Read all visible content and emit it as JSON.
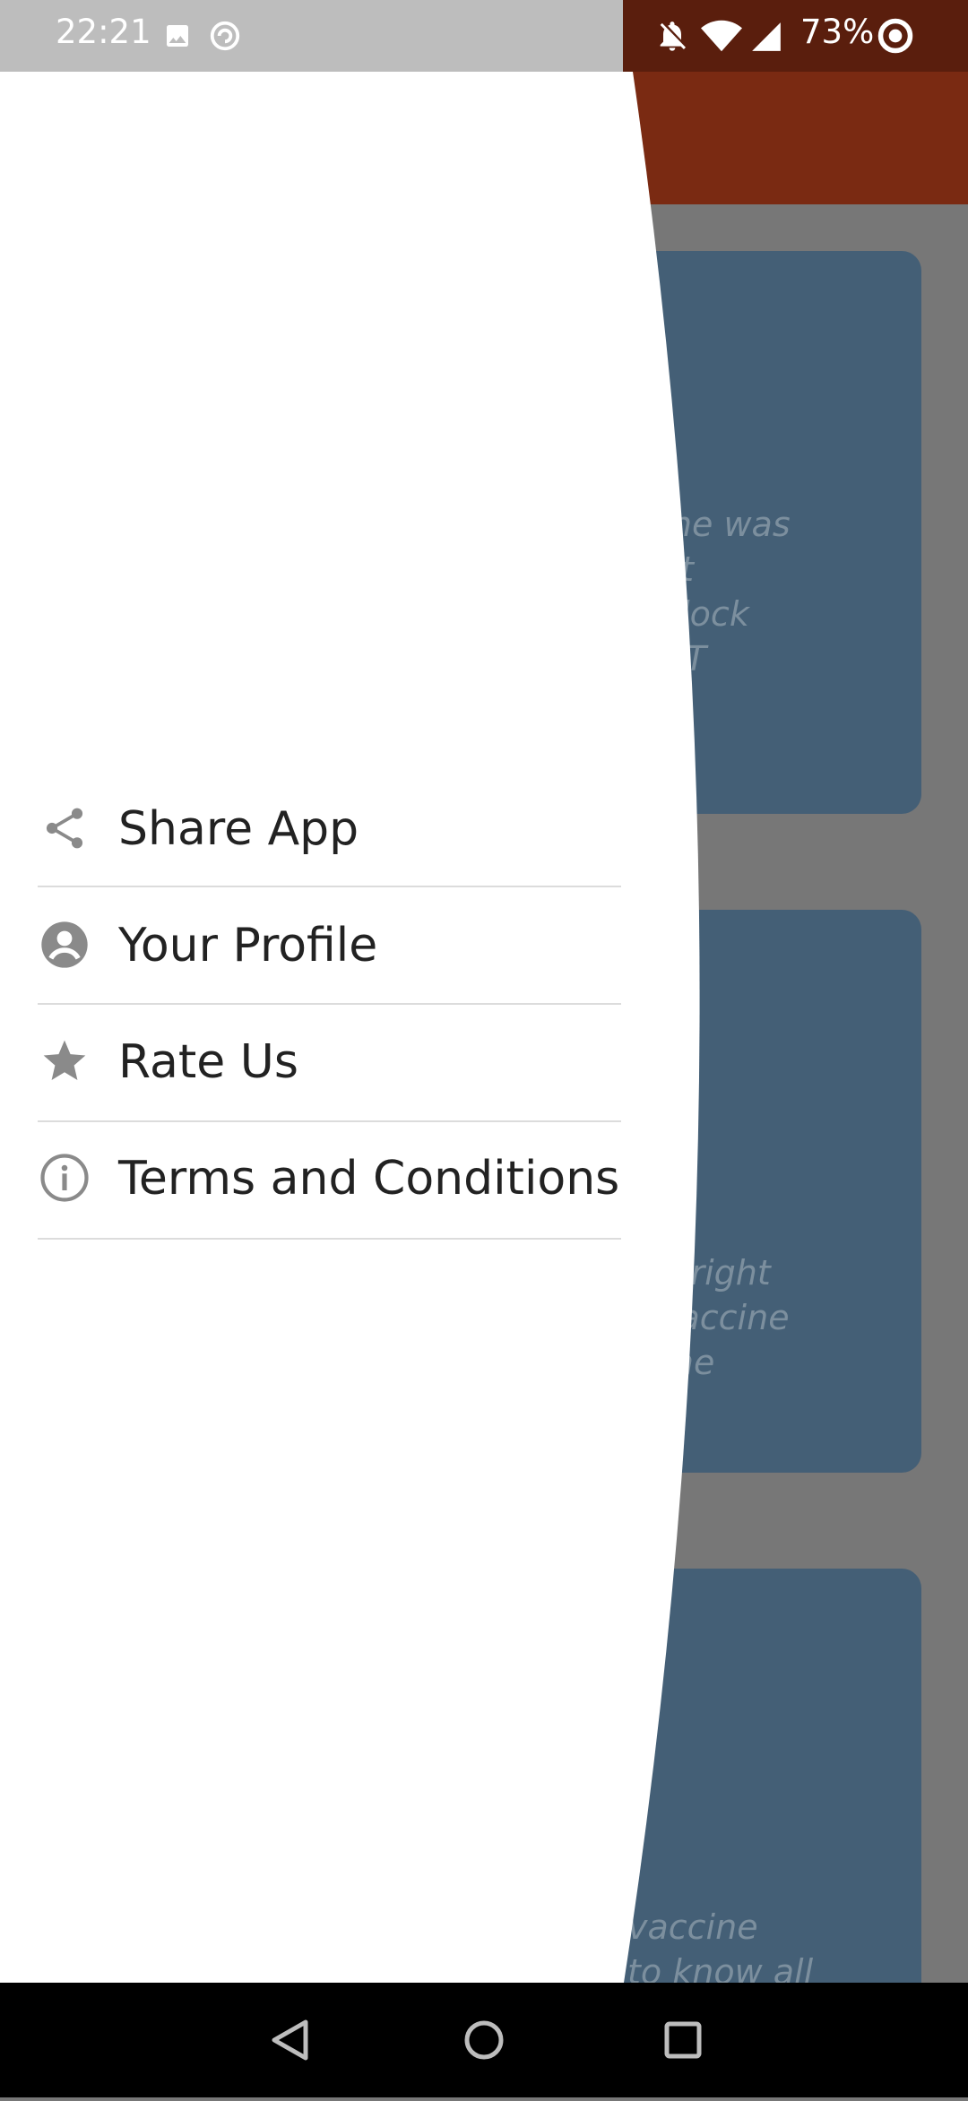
{
  "status_bar": {
    "time": "22:21",
    "battery": "73%",
    "left_icons": [
      "image-icon",
      "sync-icon"
    ],
    "right_icons": [
      "bell-off-icon",
      "wifi-icon",
      "signal-icon",
      "battery-ring-icon"
    ]
  },
  "background_cards": [
    {
      "text": "me was\nnt\nblock\nOT"
    },
    {
      "text": "e right\nvaccine\nthe"
    },
    {
      "text": "vaccine\nto know all"
    }
  ],
  "drawer": {
    "items": [
      {
        "label": "Share App",
        "icon": "share-icon"
      },
      {
        "label": "Your Profile",
        "icon": "profile-icon"
      },
      {
        "label": "Rate Us",
        "icon": "star-icon"
      },
      {
        "label": "Terms and Conditions",
        "icon": "info-icon"
      }
    ]
  },
  "nav_bar": {
    "buttons": [
      "back-icon",
      "home-icon",
      "recents-icon"
    ]
  },
  "colors": {
    "app_bar": "#7a2a12",
    "card": "#445f76",
    "scrim_bg": "#777777",
    "drawer_bg": "#ffffff",
    "text": "#222222",
    "icon": "#8a8a8a"
  }
}
